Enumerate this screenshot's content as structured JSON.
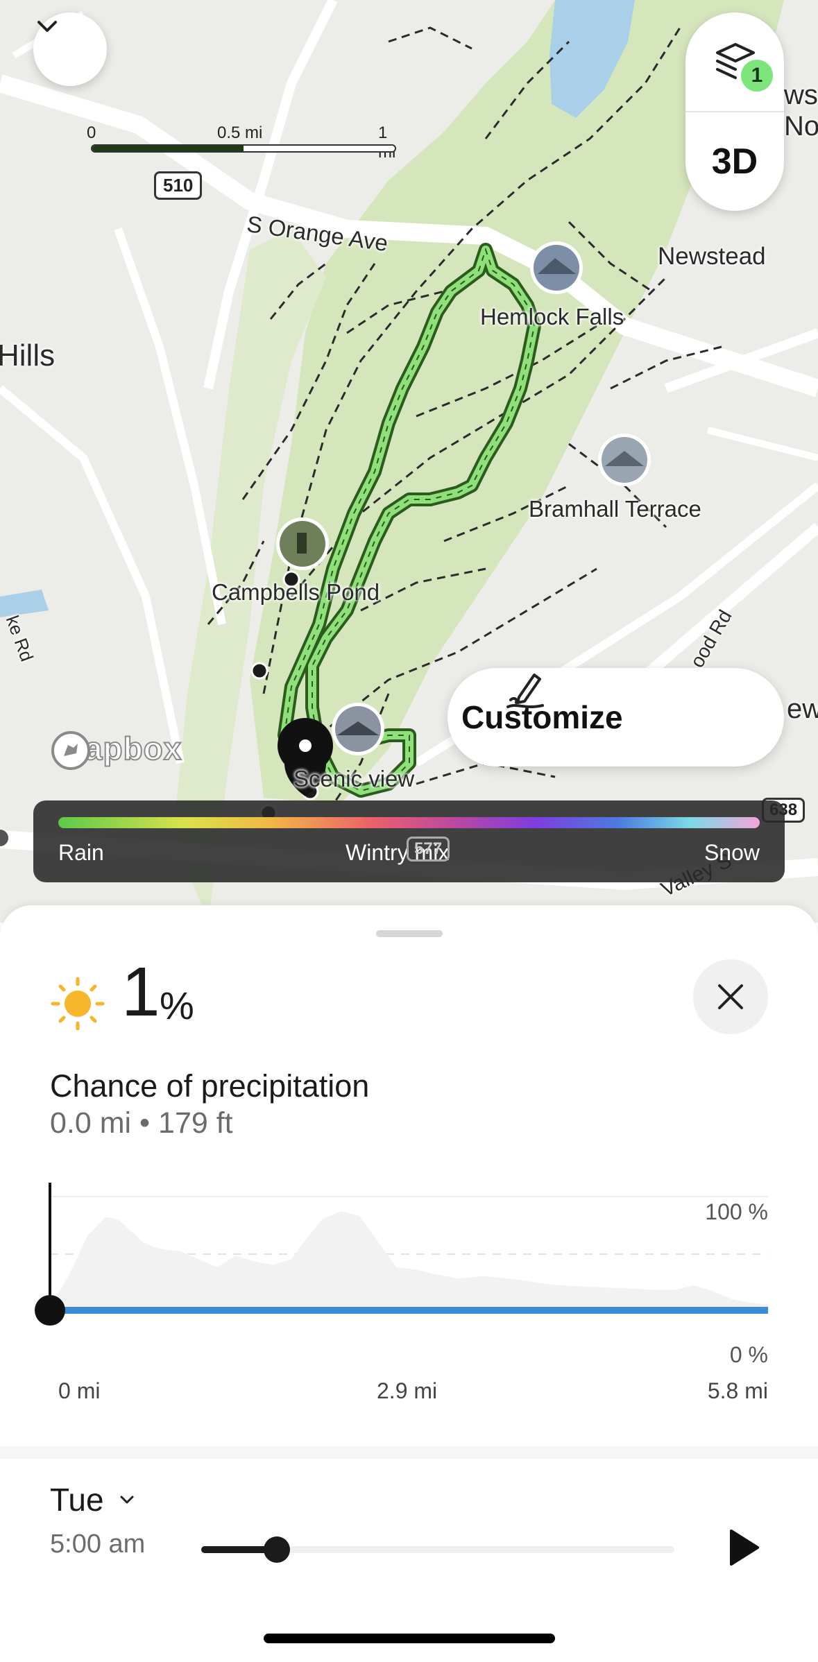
{
  "map": {
    "scale": {
      "labels": [
        "0",
        "0.5 mi",
        "1 mi"
      ]
    },
    "layers": {
      "icon": "layers-icon",
      "count": "1"
    },
    "three_d_label": "3D",
    "collapse_icon": "chevron-down-icon",
    "place_labels": {
      "orange_ave": "S Orange Ave",
      "newstead": "Newstead",
      "hemlock_falls": "Hemlock Falls",
      "bramhall_terrace": "Bramhall Terrace",
      "campbells_pond": "Campbells Pond",
      "scenic_view": "Scenic view",
      "hills": "Hills",
      "news_partial": "ws",
      "no_partial": "No",
      "ew_partial": "ew",
      "rd_left": "ke Rd",
      "rd_right": "ood Rd",
      "valley": "Valley S"
    },
    "road_shields": {
      "r510": "510",
      "r638": "638",
      "r577": "577"
    },
    "customize": {
      "label": "Customize",
      "icon": "pencil-signature-icon"
    },
    "attribution": "mapbox",
    "legend": {
      "rain": "Rain",
      "wintry": "Wintry mix",
      "snow": "Snow"
    }
  },
  "panel": {
    "weather_icon": "sun-icon",
    "value": "1",
    "unit": "%",
    "title": "Chance of precipitation",
    "subtitle": "0.0 mi • 179 ft",
    "close_icon": "close-icon"
  },
  "chart_data": {
    "type": "area",
    "title": "",
    "xlabel": "",
    "ylabel": "",
    "x_ticks": [
      "0 mi",
      "2.9 mi",
      "5.8 mi"
    ],
    "y_ticks": [
      "100 %",
      "0 %"
    ],
    "ylim": [
      0,
      100
    ],
    "xlim": [
      0,
      5.8
    ],
    "grid": "dashed midline",
    "series": [
      {
        "x": [
          0,
          0.15,
          0.3,
          0.45,
          0.55,
          0.65,
          0.75,
          0.85,
          0.95,
          1.05,
          1.2,
          1.35,
          1.5,
          1.65,
          1.8,
          1.95,
          2.05,
          2.2,
          2.35,
          2.5,
          2.65,
          2.8,
          2.95,
          3.1,
          3.3,
          3.5,
          3.7,
          3.9,
          4.1,
          4.3,
          4.5,
          4.7,
          4.9,
          5.05,
          5.2,
          5.35,
          5.5,
          5.65,
          5.8
        ],
        "values": [
          3,
          30,
          65,
          82,
          80,
          70,
          60,
          55,
          53,
          52,
          45,
          38,
          48,
          43,
          40,
          45,
          60,
          80,
          87,
          83,
          60,
          38,
          36,
          32,
          28,
          30,
          28,
          25,
          22,
          21,
          20,
          19,
          18,
          18,
          22,
          17,
          10,
          7,
          5
        ]
      }
    ],
    "cursor_x": 0.0
  },
  "time_control": {
    "day": "Tue",
    "time": "5:00 am",
    "progress": 0.16,
    "play_icon": "play-icon",
    "dropdown_icon": "chevron-down-icon"
  }
}
